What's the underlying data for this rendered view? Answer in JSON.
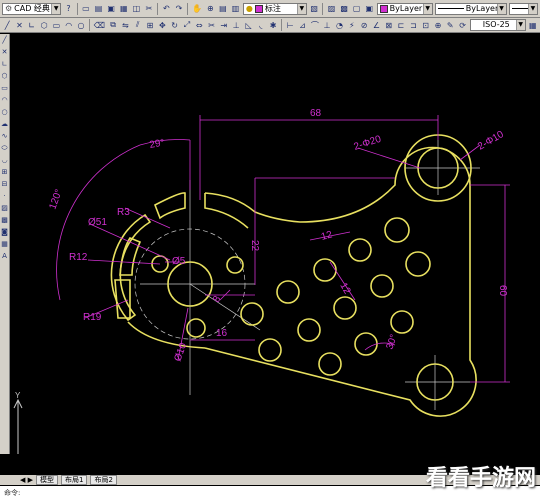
{
  "toolbar": {
    "workspace_combo": "CAD 经典",
    "layer_combo": "标注",
    "color_combo": "ByLayer",
    "linetype_combo": "ByLayer",
    "dimstyle_combo": "ISO-25"
  },
  "drawing": {
    "dims": {
      "d68": "68",
      "d2phi20": "2-Φ20",
      "d2phi10": "2-Φ10",
      "d29": "29°",
      "d120": "120°",
      "r3": "R3",
      "phi51": "Ø51",
      "phi5": "Ø5",
      "r12": "R12",
      "r19": "R19",
      "phi10": "Ø10",
      "d8": "8",
      "d16": "16",
      "d22": "22",
      "d12a": "12",
      "d12b": "12",
      "d30": "30°",
      "d60": "60"
    },
    "ucs_x": "X",
    "ucs_y": "Y"
  },
  "tabs": [
    "模型",
    "布局1",
    "布局2"
  ],
  "command_prompt": "命令:",
  "watermark": "看看手游网",
  "colors": {
    "yellow": "#e8e060",
    "magenta": "#d030d0",
    "white": "#c8c8c8"
  }
}
